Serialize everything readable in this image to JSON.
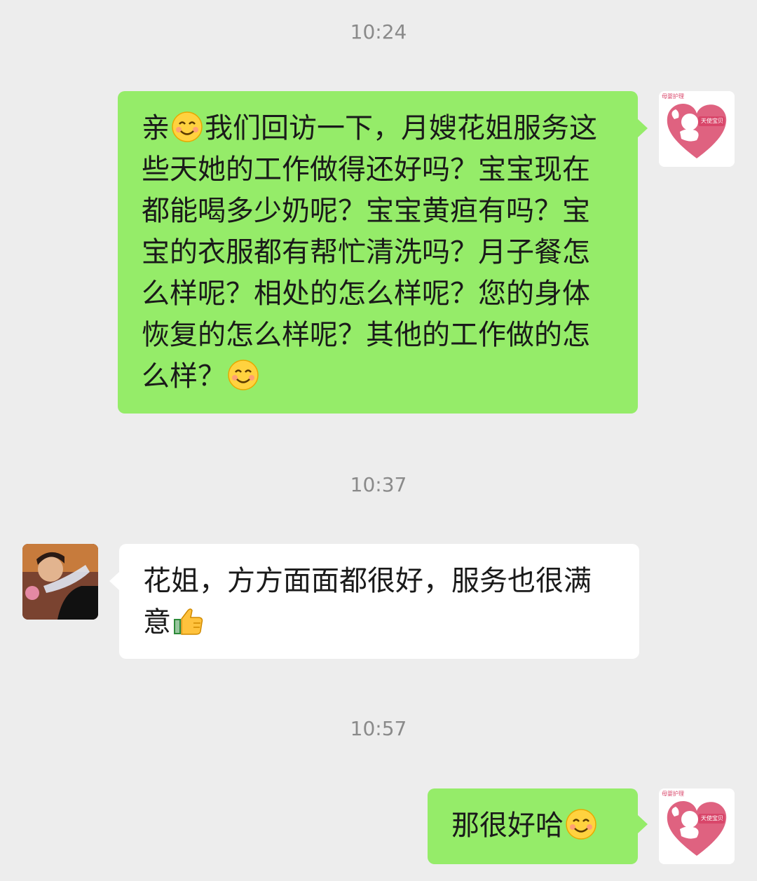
{
  "timestamps": [
    "10:24",
    "10:37",
    "10:57"
  ],
  "messages": [
    {
      "text_a": "亲",
      "text_b": "我们回访一下，月嫂花姐服务这些天她的工作做得还好吗？宝宝现在都能喝多少奶呢？宝宝黄疸有吗？宝宝的衣服都有帮忙清洗吗？月子餐怎么样呢？相处的怎么样呢？您的身体恢复的怎么样呢？其他的工作做的怎么样？"
    },
    {
      "text": "花姐，方方面面都很好，服务也很满意"
    },
    {
      "text": "那很好哈"
    }
  ],
  "sender_avatar": {
    "tiny_label": "母婴护理",
    "badge": "天使宝贝"
  },
  "icons": [
    "smile-emoji-icon",
    "thumbs-up-emoji-icon"
  ],
  "colors": {
    "background": "#ededed",
    "outgoing_bubble": "#95ec69",
    "incoming_bubble": "#ffffff",
    "timestamp": "#8a8a8a"
  }
}
